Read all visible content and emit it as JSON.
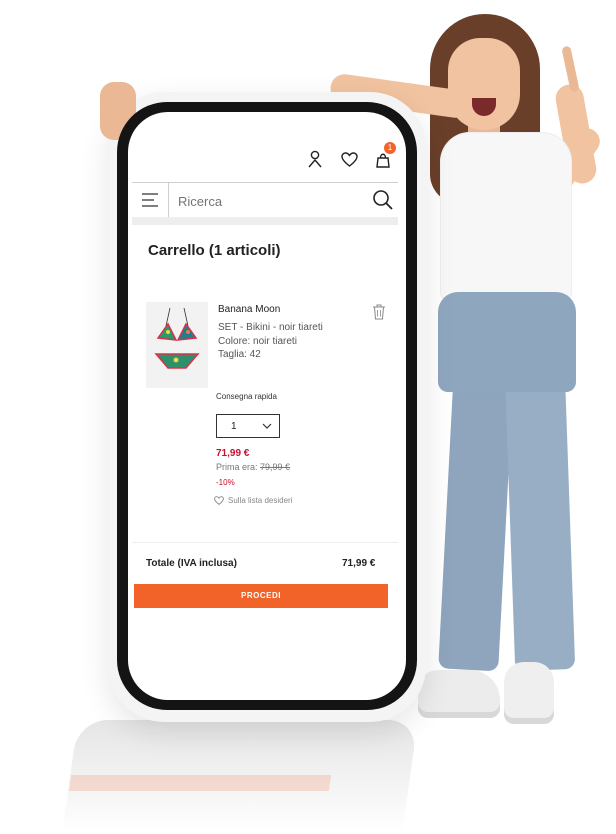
{
  "header": {
    "account_icon": "user-icon",
    "wishlist_icon": "heart-icon",
    "bag_icon": "shopping-bag-icon",
    "bag_count": "1"
  },
  "search": {
    "value": "",
    "placeholder": "Ricerca"
  },
  "cart": {
    "title": "Carrello (1 articoli)",
    "item": {
      "brand": "Banana Moon",
      "name": "SET - Bikini - noir tiareti",
      "color": "Colore: noir tiareti",
      "size": "Taglia: 42",
      "delivery": "Consegna rapida",
      "quantity": "1",
      "price": "71,99 €",
      "old_price_label": "Prima era:",
      "old_price": "79,99 €",
      "discount": "-10%",
      "wishlist_label": "Sulla lista desideri"
    },
    "total_label": "Totale (IVA inclusa)",
    "total_value": "71,99 €",
    "checkout_label": "PROCEDI"
  },
  "colors": {
    "accent": "#f2632a",
    "sale": "#c8102e"
  }
}
